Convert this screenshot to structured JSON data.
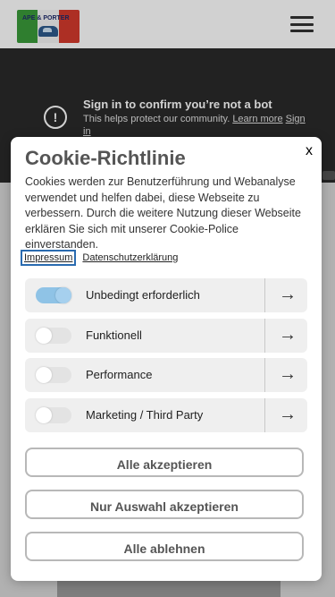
{
  "header": {
    "logo_text": "APE & PORTER"
  },
  "video": {
    "notice_title": "Sign in to confirm you’re not a bot",
    "notice_text": "This helps protect our community.",
    "learn_more": "Learn more",
    "sign_in": "Sign in"
  },
  "cookie": {
    "title": "Cookie-Richtlinie",
    "close": "x",
    "description": "Cookies werden zur Benutzerführung und Webanalyse verwendet und helfen dabei, diese Webseite zu verbessern. Durch die weitere Nutzung dieser Webseite erklären Sie sich mit unserer Cookie-Police einverstanden.",
    "links": {
      "impressum": "Impressum",
      "datenschutz": "Datenschutzerklärung"
    },
    "categories": [
      {
        "label": "Unbedingt erforderlich",
        "enabled": true
      },
      {
        "label": "Funktionell",
        "enabled": false
      },
      {
        "label": "Performance",
        "enabled": false
      },
      {
        "label": "Marketing / Third Party",
        "enabled": false
      }
    ],
    "arrow": "→",
    "buttons": {
      "accept_all": "Alle akzeptieren",
      "accept_selection": "Nur Auswahl akzeptieren",
      "reject_all": "Alle ablehnen"
    }
  },
  "colors": {
    "toggle_on": "#8fc3e6",
    "toggle_off": "#e3e3e3",
    "focus_outline": "#2a6bb0"
  }
}
